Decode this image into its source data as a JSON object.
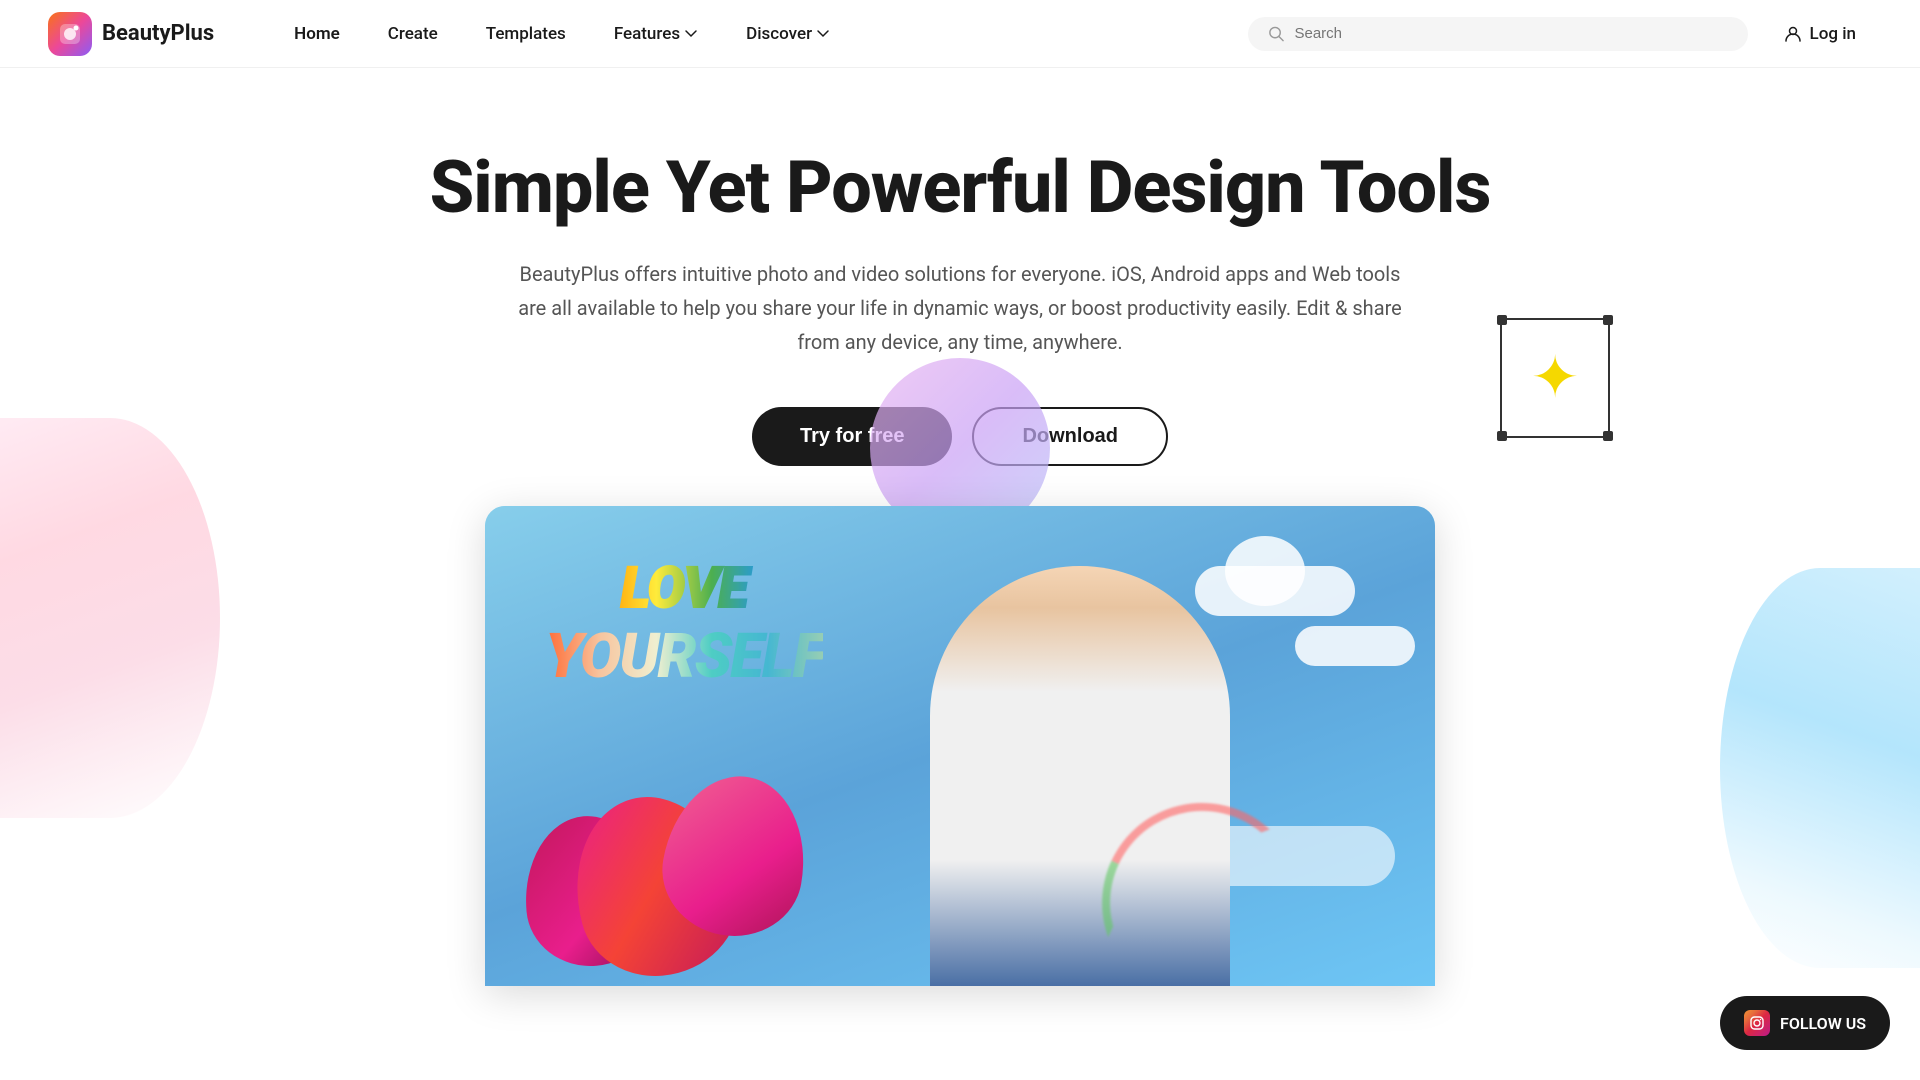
{
  "nav": {
    "logo_text": "BeautyPlus",
    "links": [
      {
        "id": "home",
        "label": "Home",
        "active": true,
        "hasDropdown": false
      },
      {
        "id": "create",
        "label": "Create",
        "active": false,
        "hasDropdown": false
      },
      {
        "id": "templates",
        "label": "Templates",
        "active": false,
        "hasDropdown": false
      },
      {
        "id": "features",
        "label": "Features",
        "active": false,
        "hasDropdown": true
      },
      {
        "id": "discover",
        "label": "Discover",
        "active": false,
        "hasDropdown": true
      }
    ],
    "search_placeholder": "Search",
    "login_label": "Log in"
  },
  "hero": {
    "title": "Simple Yet Powerful Design Tools",
    "subtitle": "BeautyPlus offers intuitive photo and video solutions for everyone. iOS, Android apps and Web tools are all available to help you share your life in dynamic ways, or boost productivity easily. Edit & share from any device, any time, anywhere.",
    "cta_primary": "Try for free",
    "cta_secondary": "Download"
  },
  "follow_badge": {
    "label": "FOLLOW US"
  },
  "image": {
    "love_line1": "LOVE",
    "love_line2": "YOURSELF"
  }
}
